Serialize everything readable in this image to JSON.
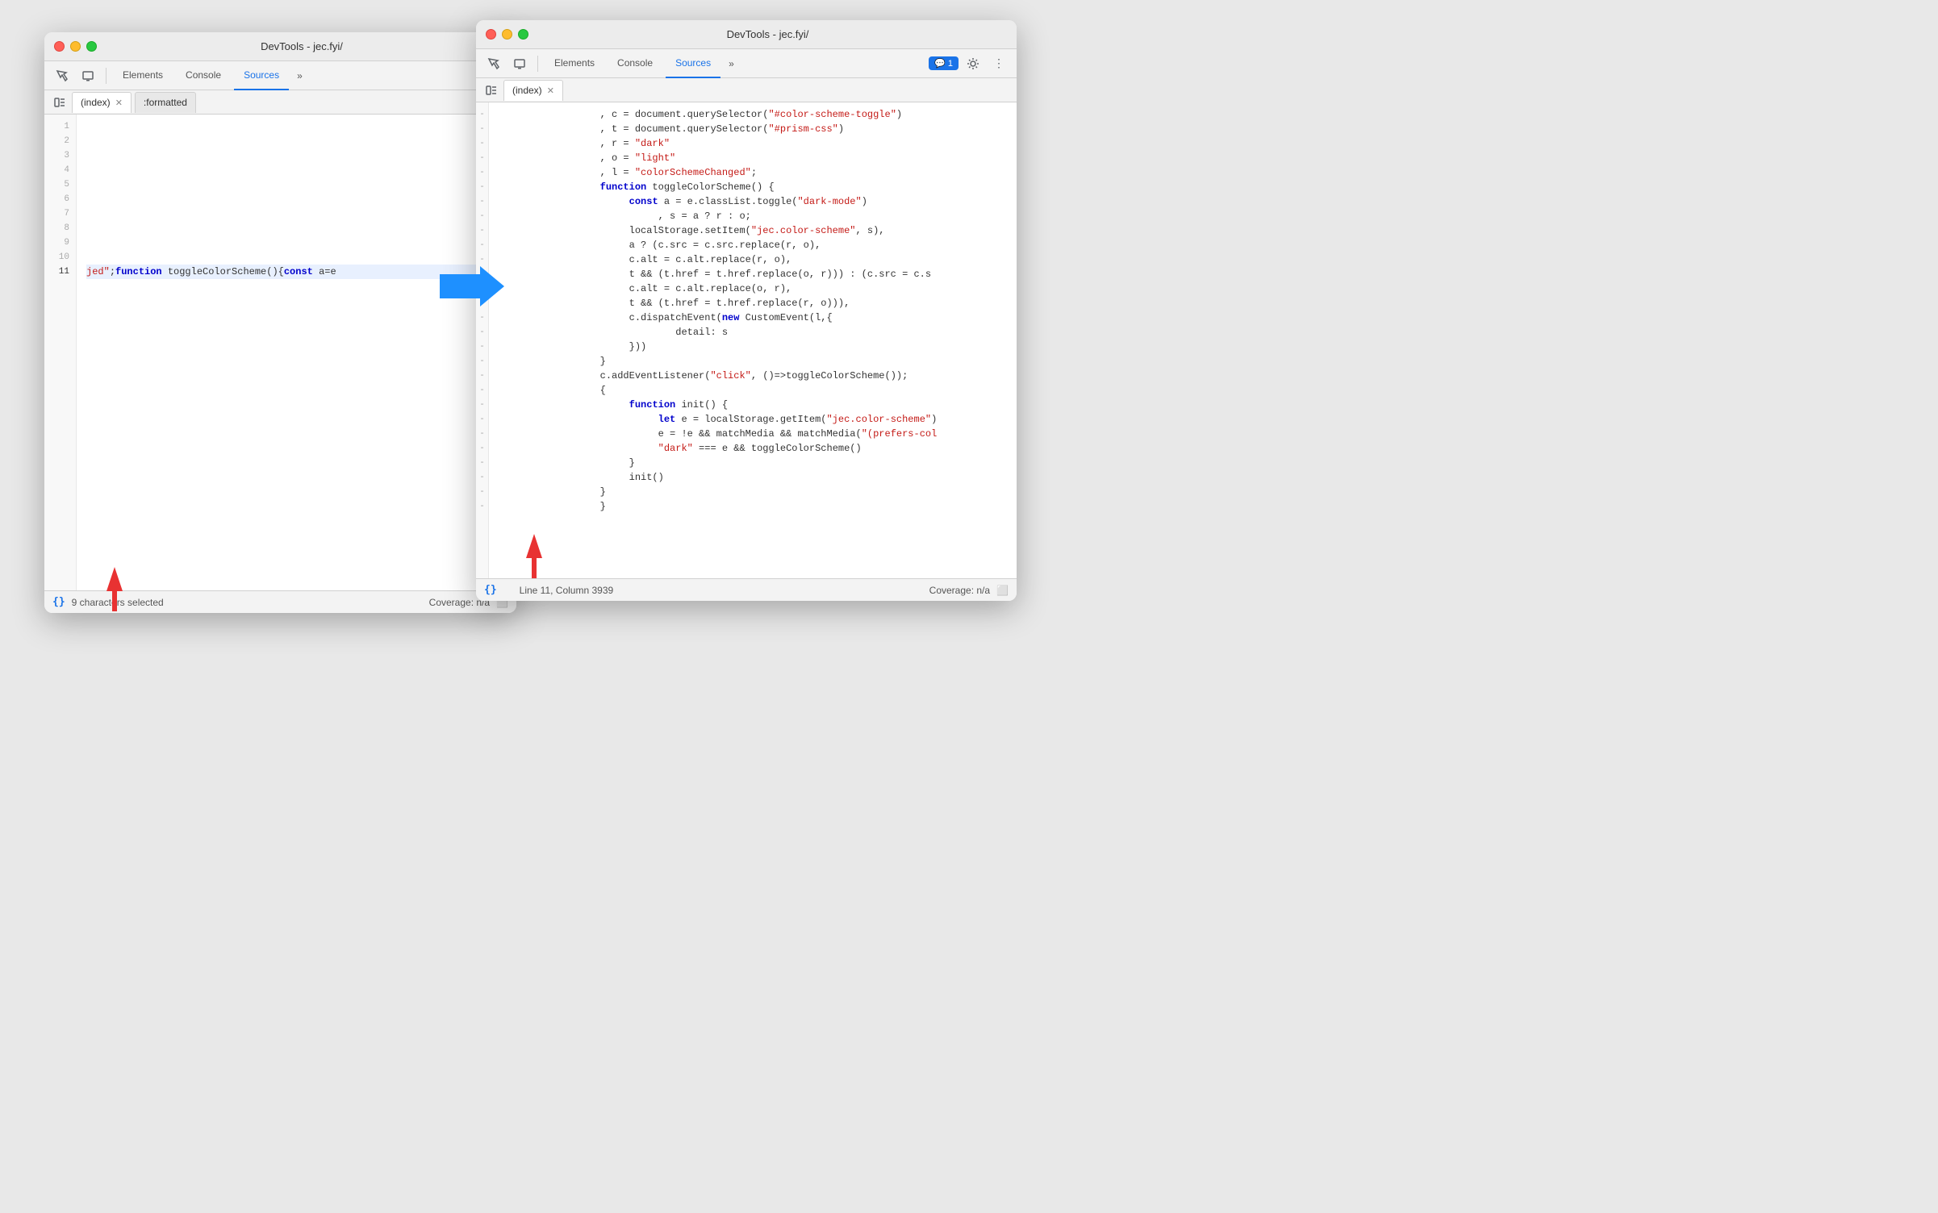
{
  "window_left": {
    "title": "DevTools - jec.fyi/",
    "tabs": [
      "Elements",
      "Console",
      "Sources"
    ],
    "active_tab": "Sources",
    "file_tabs": [
      {
        "name": "(index)",
        "closeable": true
      },
      {
        "name": ":formatted",
        "closeable": false
      }
    ],
    "status_bar": {
      "format_icon": "{}",
      "selection_text": "9 characters selected",
      "coverage": "Coverage: n/a"
    },
    "lines": [
      {
        "num": 1,
        "code": ""
      },
      {
        "num": 2,
        "code": ""
      },
      {
        "num": 3,
        "code": ""
      },
      {
        "num": 4,
        "code": ""
      },
      {
        "num": 5,
        "code": ""
      },
      {
        "num": 6,
        "code": ""
      },
      {
        "num": 7,
        "code": ""
      },
      {
        "num": 8,
        "code": ""
      },
      {
        "num": 9,
        "code": ""
      },
      {
        "num": 10,
        "code": ""
      },
      {
        "num": 11,
        "code": "jed\";function toggleColorScheme(){const a=e"
      }
    ]
  },
  "window_right": {
    "title": "DevTools - jec.fyi/",
    "tabs": [
      "Elements",
      "Console",
      "Sources"
    ],
    "active_tab": "Sources",
    "badge": "1",
    "file_tabs": [
      {
        "name": "(index)",
        "closeable": true
      }
    ],
    "status_bar": {
      "format_icon": "{}",
      "position_text": "Line 11, Column 3939",
      "coverage": "Coverage: n/a"
    },
    "code_lines": [
      ", c = document.querySelector(\"#color-scheme-toggle\")",
      ", t = document.querySelector(\"#prism-css\")",
      ", r = \"dark\"",
      ", o = \"light\"",
      ", l = \"colorSchemeChanged\";",
      "function toggleColorScheme() {",
      "    const a = e.classList.toggle(\"dark-mode\")",
      "        , s = a ? r : o;",
      "    localStorage.setItem(\"jec.color-scheme\", s),",
      "    a ? (c.src = c.src.replace(r, o),",
      "    c.alt = c.alt.replace(r, o),",
      "    t && (t.href = t.href.replace(o, r))) : (c.src = c.s",
      "    c.alt = c.alt.replace(o, r),",
      "    t && (t.href = t.href.replace(r, o))),",
      "    c.dispatchEvent(new CustomEvent(l,{",
      "        detail: s",
      "    }))",
      "}",
      "c.addEventListener(\"click\", ()=>toggleColorScheme());",
      "{",
      "    function init() {",
      "        let e = localStorage.getItem(\"jec.color-scheme\")",
      "        e = !e && matchMedia && matchMedia(\"(prefers-col",
      "        \"dark\" === e && toggleColorScheme()",
      "    }",
      "    init()",
      "}",
      "}"
    ]
  }
}
